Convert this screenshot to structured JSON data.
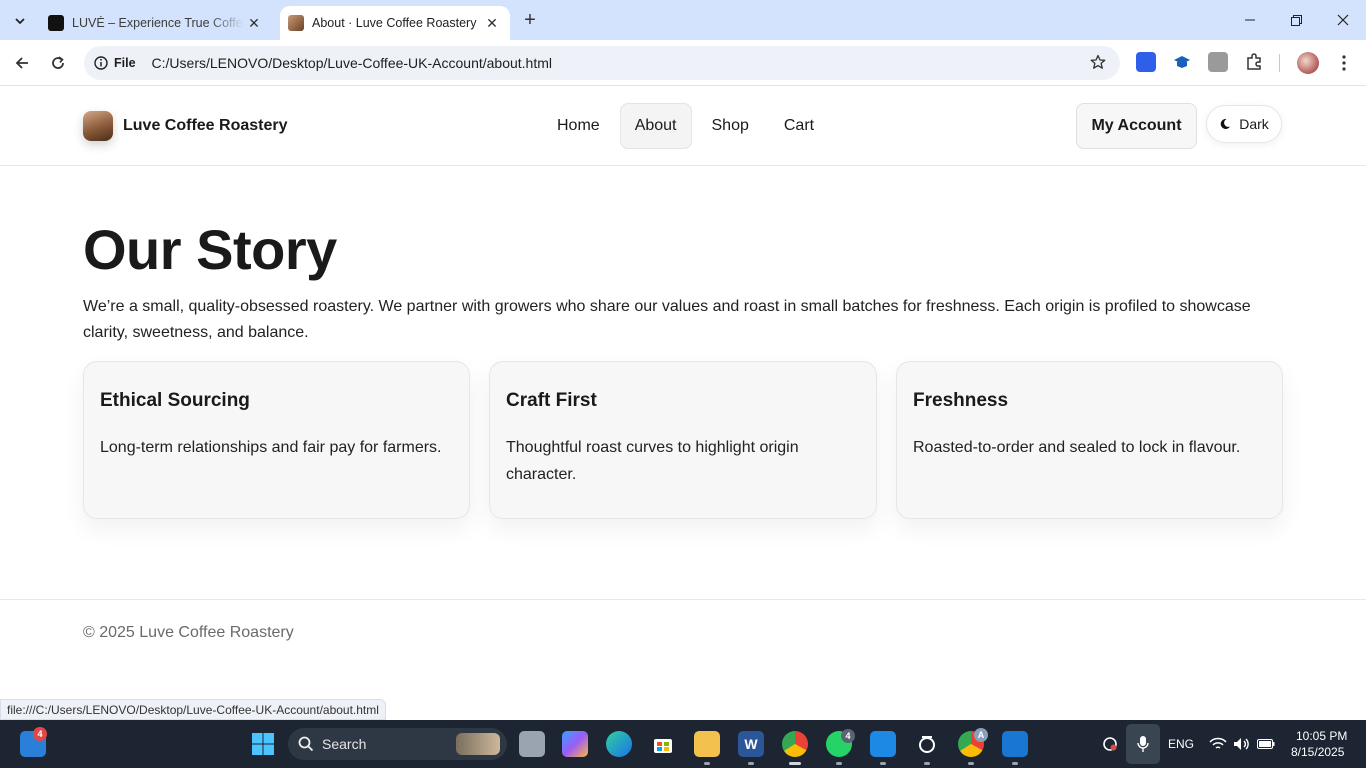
{
  "browser": {
    "tabs": [
      {
        "title": "LUVÉ – Experience True Coffee E",
        "active": false
      },
      {
        "title": "About · Luve Coffee Roastery",
        "active": true
      }
    ],
    "site_info_label": "File",
    "url": "C:/Users/LENOVO/Desktop/Luve-Coffee-UK-Account/about.html",
    "status_url": "file:///C:/Users/LENOVO/Desktop/Luve-Coffee-UK-Account/about.html"
  },
  "site": {
    "brand": "Luve Coffee Roastery",
    "nav": [
      {
        "label": "Home",
        "active": false
      },
      {
        "label": "About",
        "active": true
      },
      {
        "label": "Shop",
        "active": false
      },
      {
        "label": "Cart",
        "active": false
      }
    ],
    "account_label": "My Account",
    "theme_toggle_label": "Dark"
  },
  "page": {
    "title": "Our Story",
    "intro": "We’re a small, quality-obsessed roastery. We partner with growers who share our values and roast in small batches for freshness. Each origin is profiled to showcase clarity, sweetness, and balance.",
    "cards": [
      {
        "title": "Ethical Sourcing",
        "text": "Long-term relationships and fair pay for farmers."
      },
      {
        "title": "Craft First",
        "text": "Thoughtful roast curves to highlight origin character."
      },
      {
        "title": "Freshness",
        "text": "Roasted-to-order and sealed to lock in flavour."
      }
    ]
  },
  "footer": {
    "copyright": "© 2025 Luve Coffee Roastery"
  },
  "taskbar": {
    "widgets_badge": "4",
    "search_placeholder": "Search",
    "whatsapp_badge": "4",
    "chrome_profile_badge": "A",
    "language": "ENG",
    "time": "10:05 PM",
    "date": "8/15/2025"
  },
  "colors": {
    "tabstrip": "#d3e3fd",
    "taskbar": "#1c2531",
    "card_bg": "#f7f7f7",
    "accent_coffee": "#8a5a3a"
  }
}
